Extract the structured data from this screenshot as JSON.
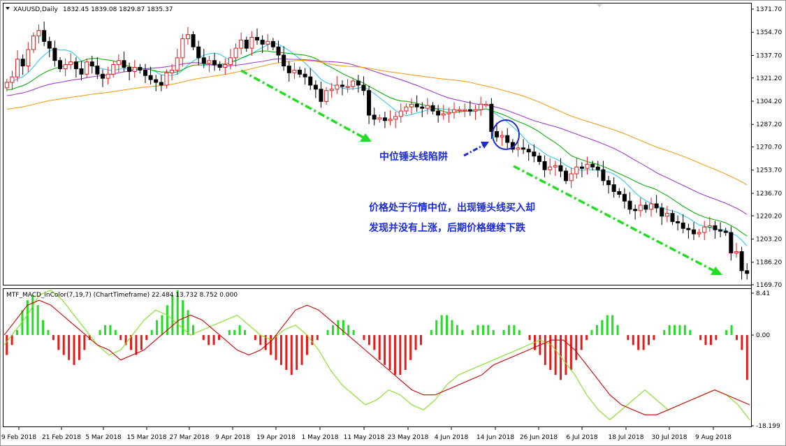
{
  "window": {
    "symbol_header": "XAUUSD,Daily",
    "ohlc_header": "1832.45 1839.08 1829.87 1835.37",
    "indicator_header": "MTF_MACD_inColor(7,19,7) (ChartTimeframe) 22.484 13.732 8.752 0.000"
  },
  "colors": {
    "bull_candle": "#e51a1a",
    "bear_candle": "#000000",
    "ma_fast": "#33c8f0",
    "ma_mid": "#10b010",
    "ma_slow": "#a040c8",
    "ma_long": "#f0a020",
    "arrow": "#22dd22",
    "annotation": "#1c2bd6",
    "hist_pos": "#22dd22",
    "hist_neg": "#e51a1a",
    "macd_line": "#cc0000",
    "signal_line": "#80e020"
  },
  "chart_data": [
    {
      "type": "candlestick",
      "y_ticks": [
        "1371.70",
        "1354.70",
        "1337.70",
        "1321.20",
        "1304.20",
        "1287.20",
        "1270.70",
        "1253.70",
        "1236.70",
        "1220.20",
        "1203.20",
        "1186.20",
        "1169.70"
      ],
      "ylim": [
        1169.7,
        1371.7
      ],
      "x_ticks": [
        "9 Feb 2018",
        "21 Feb 2018",
        "5 Mar 2018",
        "15 Mar 2018",
        "27 Mar 2018",
        "9 Apr 2018",
        "19 Apr 2018",
        "1 May 2018",
        "11 May 2018",
        "23 May 2018",
        "4 Jun 2018",
        "14 Jun 2018",
        "26 Jun 2018",
        "6 Jul 2018",
        "18 Jul 2018",
        "30 Jul 2018",
        "9 Aug 2018"
      ],
      "close_series": [
        1318,
        1322,
        1335,
        1330,
        1342,
        1352,
        1356,
        1348,
        1343,
        1334,
        1328,
        1331,
        1333,
        1328,
        1324,
        1333,
        1330,
        1324,
        1321,
        1324,
        1331,
        1334,
        1329,
        1326,
        1329,
        1327,
        1323,
        1320,
        1318,
        1316,
        1325,
        1327,
        1336,
        1350,
        1353,
        1344,
        1336,
        1332,
        1334,
        1331,
        1329,
        1331,
        1336,
        1343,
        1349,
        1343,
        1351,
        1349,
        1346,
        1348,
        1344,
        1338,
        1330,
        1325,
        1327,
        1324,
        1322,
        1316,
        1313,
        1304,
        1312,
        1313,
        1316,
        1315,
        1315,
        1319,
        1316,
        1312,
        1294,
        1291,
        1292,
        1290,
        1291,
        1293,
        1297,
        1300,
        1302,
        1300,
        1299,
        1301,
        1297,
        1294,
        1295,
        1296,
        1298,
        1298,
        1298,
        1297,
        1298,
        1302,
        1302,
        1282,
        1278,
        1279,
        1274,
        1269,
        1270,
        1269,
        1267,
        1264,
        1260,
        1254,
        1256,
        1257,
        1253,
        1246,
        1251,
        1256,
        1255,
        1258,
        1256,
        1254,
        1246,
        1243,
        1238,
        1236,
        1231,
        1225,
        1224,
        1228,
        1225,
        1229,
        1226,
        1220,
        1222,
        1216,
        1215,
        1211,
        1210,
        1207,
        1208,
        1212,
        1213,
        1210,
        1209,
        1208,
        1193,
        1194,
        1180,
        1178
      ],
      "series": [
        {
          "name": "MA fast",
          "color_key": "ma_fast"
        },
        {
          "name": "MA mid",
          "color_key": "ma_mid"
        },
        {
          "name": "MA slow",
          "color_key": "ma_slow"
        },
        {
          "name": "MA long",
          "color_key": "ma_long"
        }
      ],
      "annotations": {
        "hammer_label": "中位锤头线陷阱",
        "comment_line1": "价格处于行情中位，出现锤头线买入却",
        "comment_line2": "发现并没有上涨，后期价格继续下跌"
      }
    },
    {
      "type": "bar",
      "y_ticks": [
        "8.41",
        "0.00",
        "-18.199"
      ],
      "ylim": [
        -18.199,
        8.41
      ],
      "histogram": [
        -4,
        -2,
        1,
        5,
        7,
        8,
        6,
        3,
        1,
        -1,
        -3,
        -4,
        -5,
        -6,
        -5,
        -3,
        -1,
        0,
        1,
        2,
        2,
        1,
        -1,
        -2,
        -3,
        -4,
        -3,
        -1,
        1,
        3,
        4,
        6,
        8,
        9,
        7,
        5,
        2,
        0,
        -1,
        -2,
        -2,
        -1,
        0,
        1,
        1,
        2,
        1,
        0,
        -1,
        -2,
        -3,
        -4,
        -5,
        -6,
        -7,
        -8,
        -7,
        -6,
        -4,
        -2,
        -1,
        0,
        1,
        2,
        3,
        3,
        2,
        1,
        0,
        -1,
        -2,
        -3,
        -5,
        -6,
        -7,
        -8,
        -8,
        -7,
        -5,
        -3,
        -2,
        0,
        1,
        3,
        4,
        4,
        3,
        2,
        1,
        0,
        1,
        2,
        2,
        2,
        1,
        0,
        1,
        2,
        2,
        1,
        0,
        -1,
        -3,
        -4,
        -6,
        -7,
        -8,
        -9,
        -8,
        -7,
        -5,
        -3,
        -1,
        1,
        2,
        3,
        4,
        4,
        2,
        0,
        -1,
        -2,
        -3,
        -3,
        -2,
        -1,
        0,
        1,
        2,
        2,
        2,
        2,
        1,
        0,
        -1,
        -2,
        -2,
        -1,
        0,
        1,
        2,
        -1,
        -3,
        -9
      ],
      "macd": [
        0,
        3,
        6,
        7,
        6,
        4,
        2,
        0,
        -2,
        -3,
        -5,
        -4,
        -3,
        -1,
        1,
        3,
        4,
        3,
        1,
        -1,
        -3,
        -4,
        -3,
        -1,
        2,
        5,
        6,
        5,
        3,
        1,
        -1,
        -3,
        -5,
        -7,
        -9,
        -11,
        -12,
        -12,
        -11,
        -10,
        -9,
        -8,
        -6,
        -5,
        -4,
        -3,
        -2,
        -1,
        -1,
        -3,
        -6,
        -9,
        -12,
        -14,
        -15,
        -16,
        -16,
        -15,
        -14,
        -13,
        -12,
        -11,
        -12,
        -13,
        -14
      ],
      "signal": [
        -2,
        1,
        4,
        8,
        9,
        7,
        4,
        1,
        -2,
        -4,
        -3,
        0,
        3,
        5,
        4,
        2,
        0,
        1,
        2,
        3,
        4,
        2,
        0,
        -1,
        1,
        2,
        0,
        -3,
        -7,
        -10,
        -12,
        -14,
        -13,
        -11,
        -12,
        -14,
        -15,
        -13,
        -10,
        -8,
        -7,
        -6,
        -5,
        -4,
        -3,
        -2,
        -1,
        -2,
        -5,
        -8,
        -12,
        -15,
        -17,
        -15,
        -13,
        -11,
        -13,
        -15,
        -14,
        -13,
        -12,
        -11,
        -12,
        -14,
        -17
      ]
    }
  ]
}
